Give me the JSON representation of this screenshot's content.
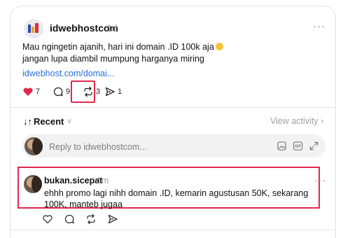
{
  "post": {
    "username": "idwebhostcom",
    "time": "1d",
    "more": "···",
    "lines": [
      "Mau ngingetin ajanih, hari ini domain .ID 100k aja",
      "jangan lupa diambil mumpung harganya miring"
    ],
    "link": "idwebhost.com/domai...",
    "counts": {
      "likes": "7",
      "replies": "9",
      "reposts": "3",
      "shares": "1"
    }
  },
  "sort": {
    "arrows": "↓↑",
    "label": "Recent",
    "chevron": "∨",
    "view_activity": "View activity ›"
  },
  "reply": {
    "placeholder": "Reply to idwebhostcom..."
  },
  "comment": {
    "username": "bukan.sicepat",
    "time": "1m",
    "more": "···",
    "text": "ehhh promo lagi nihh domain .ID, kemarin agustusan 50K, sekarang 100K, manteb jugaa"
  },
  "icons": {
    "like": "heart-icon",
    "reply": "comment-icon",
    "repost": "repost-icon",
    "share": "send-icon",
    "image": "image-icon",
    "gif": "gif-icon",
    "expand": "expand-icon"
  },
  "colors": {
    "accent_red": "#e0284d",
    "heart": "#e0284d",
    "link": "#2b6fd6"
  }
}
